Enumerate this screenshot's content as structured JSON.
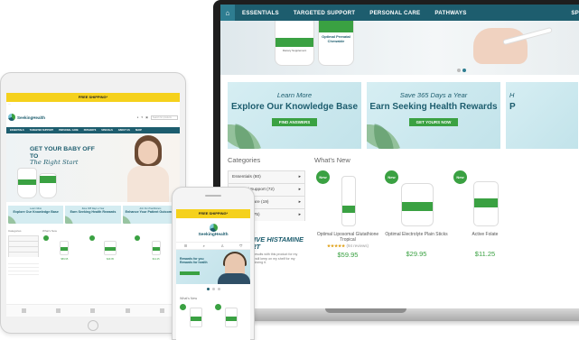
{
  "laptop": {
    "nav": {
      "home_icon": "home-icon",
      "items": [
        "ESSENTIALS",
        "TARGETED SUPPORT",
        "PERSONAL CARE",
        "PATHWAYS",
        "SP"
      ]
    },
    "hero": {
      "bottle_label_1": "Dietary Supplement",
      "bottle_label_2": "Optimal Prenatal Chewable"
    },
    "cards": [
      {
        "sub": "Learn More",
        "head": "Explore Our Knowledge Base",
        "button": "FIND ANSWERS"
      },
      {
        "sub": "Save 365 Days a Year",
        "head": "Earn Seeking Health Rewards",
        "button": "GET YOURS NOW"
      },
      {
        "sub": "H",
        "head": "P",
        "button": ""
      }
    ],
    "categories": {
      "title": "Categories",
      "items": [
        {
          "label": "Essentials (80)",
          "arrow": "▸"
        },
        {
          "label": "Targeted Support (72)",
          "arrow": "▸"
        },
        {
          "label": "Personal Care (19)",
          "arrow": "▸"
        },
        {
          "label": "Pathways (75)",
          "arrow": "▸"
        }
      ]
    },
    "promo": {
      "stars": "★★★★★",
      "title": "EFFECTIVE HISTAMINE SUPPORT",
      "text": "I have seen great results with this product for my patients. Definitely will keep on my shelf for my patients. They are loving it."
    },
    "whats_new": {
      "title": "What's New",
      "badge": "New",
      "products": [
        {
          "name": "Optimal Liposomal Glutathione Tropical",
          "stars": "★★★★★",
          "reviews": "(94 reviews)",
          "price": "$59.95"
        },
        {
          "name": "Optimal Electrolyte Plain Sticks",
          "stars": "",
          "reviews": "",
          "price": "$29.95"
        },
        {
          "name": "Active Folate",
          "stars": "",
          "reviews": "",
          "price": "$11.25"
        }
      ]
    }
  },
  "tablet": {
    "banner": "FREE SHIPPING*",
    "logo": "SeekingHealth",
    "search_placeholder": "Search for products",
    "nav_items": [
      "ESSENTIALS",
      "TARGETED SUPPORT",
      "PERSONAL CARE",
      "PATHWAYS",
      "SPECIALS",
      "ABOUT US",
      "SHOP"
    ],
    "hero_title": "GET YOUR BABY OFF TO",
    "hero_title_italic": "The Right Start",
    "cards": [
      {
        "sub": "Learn More",
        "head": "Explore Our Knowledge Base"
      },
      {
        "sub": "Save 365 Days a Year",
        "head": "Earn Seeking Health Rewards"
      },
      {
        "sub": "Join Our Practitioners",
        "head": "Enhance Your Patient Outcomes"
      }
    ],
    "categories_title": "Categories",
    "whats_new_title": "What's New",
    "prices": [
      "$59.95",
      "$29.95",
      "$11.25"
    ]
  },
  "phone": {
    "banner": "FREE SHIPPING*",
    "logo": "SeekingHealth",
    "icons": [
      "menu-icon",
      "search-icon",
      "account-icon",
      "cart-icon"
    ],
    "icon_glyphs": [
      "☰",
      "⌕",
      "♙",
      "⛉"
    ],
    "hero_text": "Rewards for you Rewards for health",
    "whats_new_title": "What's New"
  },
  "colors": {
    "primary": "#1d5d6e",
    "accent": "#3aa142",
    "banner": "#f5d11c"
  }
}
